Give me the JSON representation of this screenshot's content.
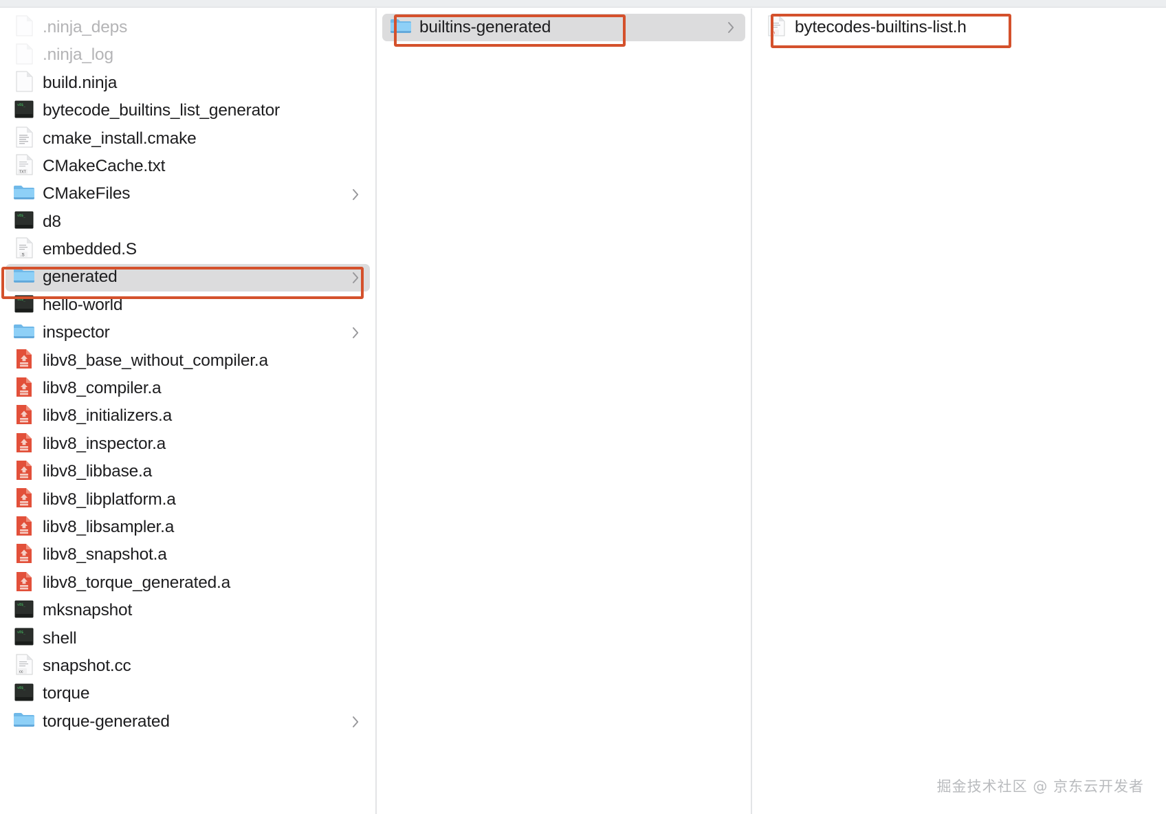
{
  "window": {
    "view": "column-view",
    "watermark": "掘金技术社区 @ 京东云开发者"
  },
  "colors": {
    "annotation_border": "#d4512c",
    "selection_background": "#dcdcdd",
    "folder_blue": "#7ec8f2",
    "archive_red": "#e2503a",
    "text": "#1d1d1f",
    "dimmed_text": "#b4b4b6",
    "chevron": "#97979a",
    "titlebar": "#eceef0",
    "divider": "#e3e4e6"
  },
  "columns": [
    {
      "name": "column-1",
      "items": [
        {
          "label": ".ninja_deps",
          "icon": "blank-document-icon",
          "kind": "file",
          "dimmed": true,
          "chevron": false,
          "selected": false
        },
        {
          "label": ".ninja_log",
          "icon": "blank-document-icon",
          "kind": "file",
          "dimmed": true,
          "chevron": false,
          "selected": false
        },
        {
          "label": "build.ninja",
          "icon": "blank-document-icon",
          "kind": "file",
          "dimmed": false,
          "chevron": false,
          "selected": false
        },
        {
          "label": "bytecode_builtins_list_generator",
          "icon": "terminal-executable-icon",
          "kind": "executable",
          "dimmed": false,
          "chevron": false,
          "selected": false
        },
        {
          "label": "cmake_install.cmake",
          "icon": "script-document-icon",
          "kind": "file",
          "dimmed": false,
          "chevron": false,
          "selected": false
        },
        {
          "label": "CMakeCache.txt",
          "icon": "text-document-icon",
          "kind": "file",
          "dimmed": false,
          "chevron": false,
          "selected": false
        },
        {
          "label": "CMakeFiles",
          "icon": "folder-icon",
          "kind": "folder",
          "dimmed": false,
          "chevron": true,
          "selected": false
        },
        {
          "label": "d8",
          "icon": "terminal-executable-icon",
          "kind": "executable",
          "dimmed": false,
          "chevron": false,
          "selected": false
        },
        {
          "label": "embedded.S",
          "icon": "asm-document-icon",
          "kind": "file",
          "dimmed": false,
          "chevron": false,
          "selected": false
        },
        {
          "label": "generated",
          "icon": "folder-icon",
          "kind": "folder",
          "dimmed": false,
          "chevron": true,
          "selected": true
        },
        {
          "label": "hello-world",
          "icon": "terminal-executable-icon",
          "kind": "executable",
          "dimmed": false,
          "chevron": false,
          "selected": false
        },
        {
          "label": "inspector",
          "icon": "folder-icon",
          "kind": "folder",
          "dimmed": false,
          "chevron": true,
          "selected": false
        },
        {
          "label": "libv8_base_without_compiler.a",
          "icon": "archive-icon",
          "kind": "archive",
          "dimmed": false,
          "chevron": false,
          "selected": false
        },
        {
          "label": "libv8_compiler.a",
          "icon": "archive-icon",
          "kind": "archive",
          "dimmed": false,
          "chevron": false,
          "selected": false
        },
        {
          "label": "libv8_initializers.a",
          "icon": "archive-icon",
          "kind": "archive",
          "dimmed": false,
          "chevron": false,
          "selected": false
        },
        {
          "label": "libv8_inspector.a",
          "icon": "archive-icon",
          "kind": "archive",
          "dimmed": false,
          "chevron": false,
          "selected": false
        },
        {
          "label": "libv8_libbase.a",
          "icon": "archive-icon",
          "kind": "archive",
          "dimmed": false,
          "chevron": false,
          "selected": false
        },
        {
          "label": "libv8_libplatform.a",
          "icon": "archive-icon",
          "kind": "archive",
          "dimmed": false,
          "chevron": false,
          "selected": false
        },
        {
          "label": "libv8_libsampler.a",
          "icon": "archive-icon",
          "kind": "archive",
          "dimmed": false,
          "chevron": false,
          "selected": false
        },
        {
          "label": "libv8_snapshot.a",
          "icon": "archive-icon",
          "kind": "archive",
          "dimmed": false,
          "chevron": false,
          "selected": false
        },
        {
          "label": "libv8_torque_generated.a",
          "icon": "archive-icon",
          "kind": "archive",
          "dimmed": false,
          "chevron": false,
          "selected": false
        },
        {
          "label": "mksnapshot",
          "icon": "terminal-executable-icon",
          "kind": "executable",
          "dimmed": false,
          "chevron": false,
          "selected": false
        },
        {
          "label": "shell",
          "icon": "terminal-executable-icon",
          "kind": "executable",
          "dimmed": false,
          "chevron": false,
          "selected": false
        },
        {
          "label": "snapshot.cc",
          "icon": "cc-document-icon",
          "kind": "file",
          "dimmed": false,
          "chevron": false,
          "selected": false
        },
        {
          "label": "torque",
          "icon": "terminal-executable-icon",
          "kind": "executable",
          "dimmed": false,
          "chevron": false,
          "selected": false
        },
        {
          "label": "torque-generated",
          "icon": "folder-icon",
          "kind": "folder",
          "dimmed": false,
          "chevron": true,
          "selected": false
        }
      ]
    },
    {
      "name": "column-2",
      "items": [
        {
          "label": "builtins-generated",
          "icon": "folder-icon",
          "kind": "folder",
          "dimmed": false,
          "chevron": true,
          "selected": true
        }
      ]
    },
    {
      "name": "column-3",
      "items": [
        {
          "label": "bytecodes-builtins-list.h",
          "icon": "header-document-icon",
          "kind": "file",
          "dimmed": false,
          "chevron": false,
          "selected": false
        }
      ]
    }
  ],
  "annotations": [
    {
      "name": "annotation-generated",
      "target": "generated"
    },
    {
      "name": "annotation-builtins",
      "target": "builtins-generated"
    },
    {
      "name": "annotation-bytecodes",
      "target": "bytecodes-builtins-list.h"
    }
  ]
}
